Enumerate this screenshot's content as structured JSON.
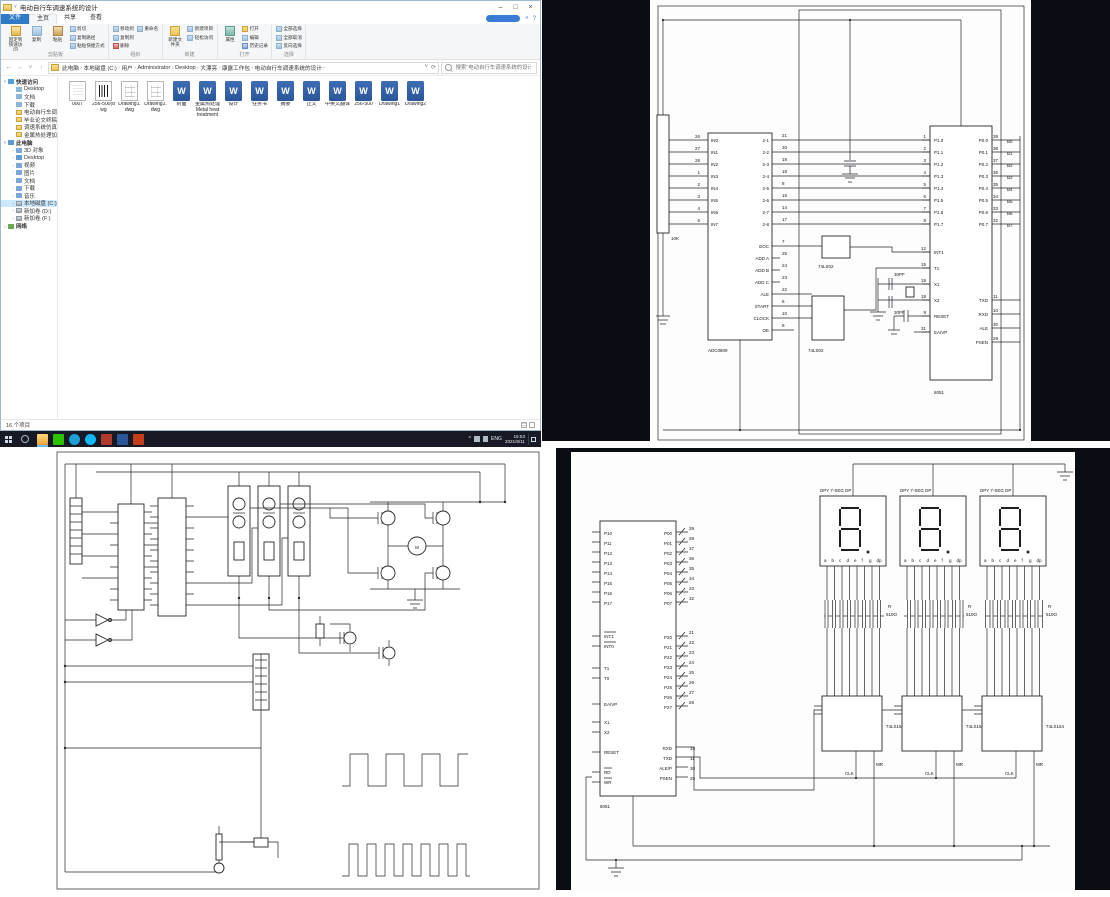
{
  "explorer": {
    "title": "电动自行车调速系统的设计",
    "window_controls": {
      "min": "–",
      "max": "□",
      "close": "×"
    },
    "tabs": {
      "file": "文件",
      "items": [
        {
          "label": "主页",
          "cls": "on"
        },
        {
          "label": "共享",
          "cls": ""
        },
        {
          "label": "查看",
          "cls": ""
        }
      ],
      "collapse": "˄",
      "help": "?"
    },
    "ribbon": {
      "groups": [
        {
          "label": "剪贴板",
          "items": [
            {
              "label": "固定到快速访问",
              "cls": "big",
              "ic": "pin"
            },
            {
              "label": "复制",
              "cls": "big",
              "ic": "copy"
            },
            {
              "label": "粘贴",
              "cls": "big",
              "ic": "paste"
            },
            {
              "label": "剪切",
              "cls": "",
              "ic": "cut"
            },
            {
              "label": "复制路径",
              "cls": "",
              "ic": "path"
            },
            {
              "label": "粘贴快捷方式",
              "cls": "",
              "ic": "link"
            }
          ]
        },
        {
          "label": "组织",
          "items": [
            {
              "label": "移动到",
              "cls": "",
              "ic": "move"
            },
            {
              "label": "复制到",
              "cls": "",
              "ic": "copyto"
            },
            {
              "label": "删除",
              "cls": "",
              "ic": "del"
            },
            {
              "label": "重命名",
              "cls": "",
              "ic": "ren"
            }
          ]
        },
        {
          "label": "新建",
          "items": [
            {
              "label": "新建文件夹",
              "cls": "big",
              "ic": "newfolder"
            },
            {
              "label": "新建项目",
              "cls": "",
              "ic": "newitem"
            },
            {
              "label": "轻松访问",
              "cls": "",
              "ic": "access"
            }
          ]
        },
        {
          "label": "打开",
          "items": [
            {
              "label": "属性",
              "cls": "big",
              "ic": "props"
            },
            {
              "label": "打开",
              "cls": "",
              "ic": "open"
            },
            {
              "label": "编辑",
              "cls": "",
              "ic": "edit"
            },
            {
              "label": "历史记录",
              "cls": "",
              "ic": "history"
            }
          ]
        },
        {
          "label": "选择",
          "items": [
            {
              "label": "全部选择",
              "cls": "",
              "ic": "selall"
            },
            {
              "label": "全部取消",
              "cls": "",
              "ic": "selnone"
            },
            {
              "label": "反向选择",
              "cls": "",
              "ic": "selinv"
            }
          ]
        }
      ]
    },
    "address": {
      "back": "←",
      "fwd": "→",
      "up": "↑",
      "refresh": "⟳",
      "dropdown": "˅",
      "sep": "›",
      "crumbs": [
        "此电脑",
        "本地磁盘 (C:)",
        "用户",
        "Administrator",
        "Desktop",
        "大漂亮",
        "康露工作包",
        "电动自行车调速系统的设计"
      ],
      "search_placeholder": "搜索\"电动自行车调速系统的设计\""
    },
    "sidebar": {
      "items": [
        {
          "label": "快速访问",
          "tw": "˅",
          "ic": "star",
          "cls": "lvl0"
        },
        {
          "label": "Desktop",
          "tw": "",
          "ic": "pin",
          "cls": "lvl1"
        },
        {
          "label": "文档",
          "tw": "",
          "ic": "pin",
          "cls": "lvl1"
        },
        {
          "label": "下载",
          "tw": "",
          "ic": "pin",
          "cls": "lvl1"
        },
        {
          "label": "电动自行车调速系统设计",
          "tw": "",
          "ic": "folder",
          "cls": "lvl1"
        },
        {
          "label": "毕业论文终稿",
          "tw": "",
          "ic": "folder",
          "cls": "lvl1"
        },
        {
          "label": "调速系统仿真",
          "tw": "",
          "ic": "folder",
          "cls": "lvl1"
        },
        {
          "label": "金属热处理加工工艺",
          "tw": "",
          "ic": "folder",
          "cls": "lvl1"
        },
        {
          "label": "此电脑",
          "tw": "˅",
          "ic": "pc",
          "cls": "lvl0"
        },
        {
          "label": "3D 对象",
          "tw": "›",
          "ic": "d3",
          "cls": "lvl1"
        },
        {
          "label": "Desktop",
          "tw": "›",
          "ic": "desk",
          "cls": "lvl1"
        },
        {
          "label": "视频",
          "tw": "›",
          "ic": "vid",
          "cls": "lvl1"
        },
        {
          "label": "图片",
          "tw": "›",
          "ic": "pic",
          "cls": "lvl1"
        },
        {
          "label": "文档",
          "tw": "›",
          "ic": "doc",
          "cls": "lvl1"
        },
        {
          "label": "下载",
          "tw": "›",
          "ic": "dl",
          "cls": "lvl1"
        },
        {
          "label": "音乐",
          "tw": "›",
          "ic": "mus",
          "cls": "lvl1"
        },
        {
          "label": "本地磁盘 (C:)",
          "tw": "›",
          "ic": "hdd",
          "cls": "lvl1 sel"
        },
        {
          "label": "新加卷 (D:)",
          "tw": "›",
          "ic": "hdd",
          "cls": "lvl1"
        },
        {
          "label": "新加卷 (F:)",
          "tw": "›",
          "ic": "hdd",
          "cls": "lvl1"
        },
        {
          "label": "网络",
          "tw": "›",
          "ic": "net",
          "cls": "lvl0"
        }
      ]
    },
    "files": [
      {
        "name": "0007",
        "type": "txt",
        "glyph": ""
      },
      {
        "name": "256-500(dwg",
        "type": "dwg-a",
        "glyph": ""
      },
      {
        "name": "Drawing1.dwg",
        "type": "dwg-b",
        "glyph": ""
      },
      {
        "name": "Drawing2.dwg",
        "type": "dwg-b",
        "glyph": ""
      },
      {
        "name": "封面",
        "type": "doc",
        "glyph": "W"
      },
      {
        "name": "金属热处理Metal heat treatment",
        "type": "doc",
        "glyph": "W"
      },
      {
        "name": "设计",
        "type": "doc",
        "glyph": "W"
      },
      {
        "name": "任务书",
        "type": "doc",
        "glyph": "W"
      },
      {
        "name": "摘要",
        "type": "doc",
        "glyph": "W"
      },
      {
        "name": "正文",
        "type": "doc",
        "glyph": "W"
      },
      {
        "name": "中英文翻译",
        "type": "doc",
        "glyph": "W"
      },
      {
        "name": "256-500",
        "type": "doc",
        "glyph": "W"
      },
      {
        "name": "Drawing1",
        "type": "doc",
        "glyph": "W"
      },
      {
        "name": "Drawing2",
        "type": "doc",
        "glyph": "W"
      }
    ],
    "status": "16 个项目"
  },
  "taskbar": {
    "apps": [
      {
        "cls": "tb-explorer on"
      },
      {
        "cls": "tb-wechat"
      },
      {
        "cls": "tb-edge"
      },
      {
        "cls": "tb-qq"
      },
      {
        "cls": "tb-cad"
      },
      {
        "cls": "tb-word"
      },
      {
        "cls": "tb-ppt"
      }
    ],
    "tray": {
      "chevron": "^",
      "lang": "ENG",
      "time": "15:53",
      "date": "2021/8/11"
    }
  },
  "schem_tr": {
    "pot": "10K",
    "adc": {
      "name": "ADC0809",
      "in_labels": [
        "IN0",
        "IN1",
        "IN2",
        "IN3",
        "IN4",
        "IN5",
        "IN6",
        "IN7"
      ],
      "in_numbers": [
        "26",
        "27",
        "28",
        "1",
        "2",
        "3",
        "4",
        "5"
      ],
      "data_labels": [
        "2-1",
        "2-2",
        "2-3",
        "2-4",
        "2-5",
        "2-6",
        "2-7",
        "2-8"
      ],
      "data_numbers": [
        "21",
        "20",
        "19",
        "18",
        "8",
        "15",
        "14",
        "17"
      ],
      "ctrl_labels": [
        "EOC",
        "ADD A",
        "ADD B",
        "ADD C",
        "ALE",
        "START",
        "CLOCK",
        "OE"
      ],
      "ctrl_numbers": [
        "7",
        "25",
        "24",
        "23",
        "22",
        "6",
        "10",
        "9"
      ]
    },
    "gate1": "74LS02",
    "gate2": "74LS02",
    "cap1": "30PF",
    "cap2": "30PF",
    "mcu": {
      "name": "8051",
      "p1_labels": [
        "P1.0",
        "P1.1",
        "P1.2",
        "P1.3",
        "P1.4",
        "P1.5",
        "P1.6",
        "P1.7"
      ],
      "p1_numbers": [
        "1",
        "2",
        "3",
        "4",
        "5",
        "6",
        "7",
        "8"
      ],
      "p0_labels": [
        "P0.0",
        "P0.1",
        "P0.2",
        "P0.3",
        "P0.4",
        "P0.5",
        "P0.6",
        "P0.7"
      ],
      "p0_numbers": [
        "39",
        "38",
        "37",
        "36",
        "35",
        "34",
        "33",
        "32"
      ],
      "bus_labels": [
        "B0",
        "B1",
        "B2",
        "B3",
        "B4",
        "B5",
        "B6",
        "B7"
      ],
      "left_low_labels": [
        "INT1",
        "T1",
        "X1",
        "X2",
        "RESET",
        "EA/VP"
      ],
      "left_low_numbers": [
        "12",
        "15",
        "19",
        "18",
        "9",
        "31"
      ],
      "right_low_labels": [
        "TXD",
        "RXD",
        "ALE",
        "PSEN"
      ],
      "right_low_numbers": [
        "11",
        "10",
        "30",
        "29"
      ]
    }
  },
  "schem_bl": {
    "motor": "M"
  },
  "schem_br": {
    "mcu": {
      "name": "8051",
      "p1_labels": [
        "P10",
        "P11",
        "P12",
        "P13",
        "P14",
        "P15",
        "P16",
        "P17"
      ],
      "p0_labels": [
        "P00",
        "P01",
        "P02",
        "P03",
        "P04",
        "P05",
        "P06",
        "P07"
      ],
      "p0_numbers": [
        "39",
        "38",
        "37",
        "36",
        "35",
        "34",
        "33",
        "32"
      ],
      "p2_labels": [
        "P20",
        "P21",
        "P22",
        "P23",
        "P24",
        "P25",
        "P26",
        "P27"
      ],
      "p2_numbers": [
        "21",
        "22",
        "23",
        "24",
        "25",
        "26",
        "27",
        "28"
      ],
      "int_labels": [
        "INT1",
        "INT0"
      ],
      "t_labels": [
        "T1",
        "T0"
      ],
      "ea_label": "EA/VP",
      "x_labels": [
        "X1",
        "X2"
      ],
      "reset_label": "RESET",
      "rw_labels": [
        "RD",
        "WR"
      ],
      "low_labels": [
        "RXD",
        "TXD",
        "ALE/P",
        "PSEN"
      ],
      "low_numbers": [
        "10",
        "11",
        "30",
        "29"
      ]
    },
    "display_label": "DPY 7-SEG DP",
    "seg_pins": [
      "a",
      "b",
      "c",
      "d",
      "e",
      "f",
      "g",
      "dp"
    ],
    "rnet_ref": "R",
    "rnet_val": "510O",
    "shift_name": "74LS164",
    "mr": "MR",
    "clk": "CLK"
  }
}
